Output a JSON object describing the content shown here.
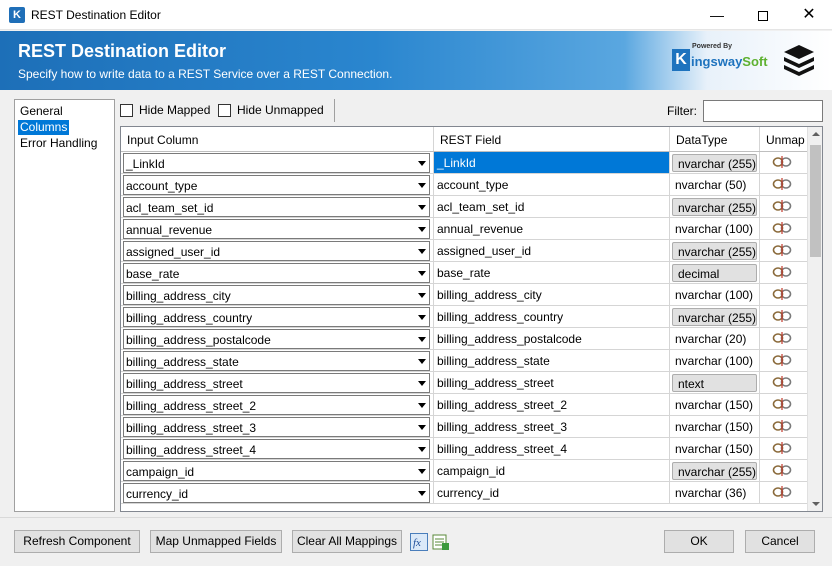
{
  "window": {
    "title": "REST Destination Editor",
    "app_icon_letter": "K",
    "controls": {
      "minimize": "—",
      "close": "✕"
    }
  },
  "banner": {
    "title": "REST Destination Editor",
    "subtitle": "Specify how to write data to a REST Service over a REST Connection.",
    "logo": {
      "powered_by": "Powered By",
      "k": "K",
      "word_a": "ingsway",
      "word_b": "Soft"
    },
    "colors": {
      "gradient_start": "#1d6fb8",
      "gradient_end": "#ffffff"
    }
  },
  "nav": {
    "items": [
      {
        "label": "General",
        "selected": false
      },
      {
        "label": "Columns",
        "selected": true
      },
      {
        "label": "Error Handling",
        "selected": false
      }
    ]
  },
  "toolbar": {
    "hide_mapped": {
      "label": "Hide Mapped",
      "checked": false
    },
    "hide_unmapped": {
      "label": "Hide Unmapped",
      "checked": false
    },
    "filter_label": "Filter:",
    "filter_value": ""
  },
  "grid": {
    "headers": {
      "input": "Input Column",
      "rest": "REST Field",
      "datatype": "DataType",
      "unmap": "Unmap"
    },
    "rows": [
      {
        "input": "_LinkId",
        "rest": "_LinkId",
        "datatype": "nvarchar (255)",
        "dt_button": true,
        "selected": true
      },
      {
        "input": "account_type",
        "rest": "account_type",
        "datatype": "nvarchar (50)",
        "dt_button": false,
        "selected": false
      },
      {
        "input": "acl_team_set_id",
        "rest": "acl_team_set_id",
        "datatype": "nvarchar (255)",
        "dt_button": true,
        "selected": false
      },
      {
        "input": "annual_revenue",
        "rest": "annual_revenue",
        "datatype": "nvarchar (100)",
        "dt_button": false,
        "selected": false
      },
      {
        "input": "assigned_user_id",
        "rest": "assigned_user_id",
        "datatype": "nvarchar (255)",
        "dt_button": true,
        "selected": false
      },
      {
        "input": "base_rate",
        "rest": "base_rate",
        "datatype": "decimal",
        "dt_button": true,
        "selected": false
      },
      {
        "input": "billing_address_city",
        "rest": "billing_address_city",
        "datatype": "nvarchar (100)",
        "dt_button": false,
        "selected": false
      },
      {
        "input": "billing_address_country",
        "rest": "billing_address_country",
        "datatype": "nvarchar (255)",
        "dt_button": true,
        "selected": false
      },
      {
        "input": "billing_address_postalcode",
        "rest": "billing_address_postalcode",
        "datatype": "nvarchar (20)",
        "dt_button": false,
        "selected": false
      },
      {
        "input": "billing_address_state",
        "rest": "billing_address_state",
        "datatype": "nvarchar (100)",
        "dt_button": false,
        "selected": false
      },
      {
        "input": "billing_address_street",
        "rest": "billing_address_street",
        "datatype": "ntext",
        "dt_button": true,
        "selected": false
      },
      {
        "input": "billing_address_street_2",
        "rest": "billing_address_street_2",
        "datatype": "nvarchar (150)",
        "dt_button": false,
        "selected": false
      },
      {
        "input": "billing_address_street_3",
        "rest": "billing_address_street_3",
        "datatype": "nvarchar (150)",
        "dt_button": false,
        "selected": false
      },
      {
        "input": "billing_address_street_4",
        "rest": "billing_address_street_4",
        "datatype": "nvarchar (150)",
        "dt_button": false,
        "selected": false
      },
      {
        "input": "campaign_id",
        "rest": "campaign_id",
        "datatype": "nvarchar (255)",
        "dt_button": true,
        "selected": false
      },
      {
        "input": "currency_id",
        "rest": "currency_id",
        "datatype": "nvarchar (36)",
        "dt_button": false,
        "selected": false
      }
    ]
  },
  "buttons": {
    "refresh": "Refresh Component",
    "map_unmapped": "Map Unmapped Fields",
    "clear_all": "Clear All Mappings",
    "fx_icon": "fx",
    "ok": "OK",
    "cancel": "Cancel"
  }
}
